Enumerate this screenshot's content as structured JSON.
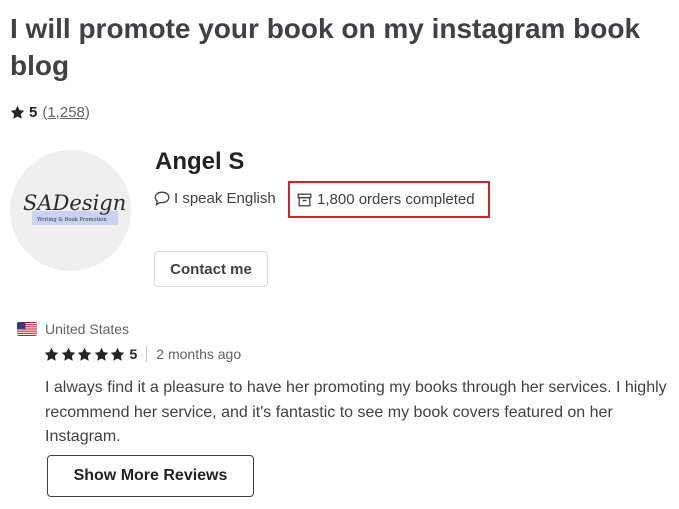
{
  "gig": {
    "title": "I will promote your book on my instagram book blog",
    "rating": "5",
    "rating_count": "(1,258)"
  },
  "seller": {
    "name": "Angel S",
    "language": "I speak English",
    "orders": "1,800 orders completed",
    "contact_label": "Contact me",
    "avatar_logo": {
      "text": "SADesign",
      "tagline": "Writing & Book Promotion"
    }
  },
  "review": {
    "country": "United States",
    "rating": "5",
    "time": "2 months ago",
    "text": "I always find it a pleasure to have her promoting my books through her services. I highly recommend her service, and it's fantastic to see my book covers featured on her Instagram."
  },
  "show_more_label": "Show More Reviews",
  "colors": {
    "text": "#404145",
    "highlight_box": "#d2232a",
    "star": "#222325"
  }
}
